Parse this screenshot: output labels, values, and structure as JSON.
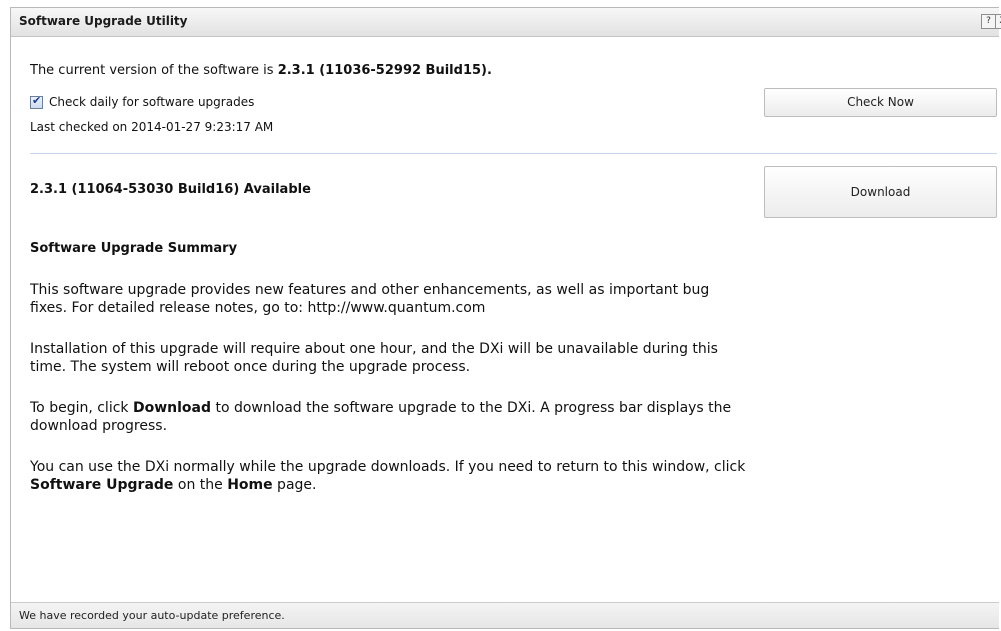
{
  "window": {
    "title": "Software Upgrade Utility",
    "help_icon": "?",
    "close_icon": "X"
  },
  "current_version": {
    "prefix": "The current version of the software is ",
    "version": "2.3.1 (11036-52992 Build15)."
  },
  "check": {
    "label": "Check daily for software upgrades",
    "checked": true,
    "last_checked": "Last checked on 2014-01-27 9:23:17 AM",
    "button": "Check Now"
  },
  "available": {
    "label": "2.3.1 (11064-53030 Build16) Available",
    "button": "Download"
  },
  "summary": {
    "title": "Software Upgrade Summary",
    "p1": "This software upgrade provides new features and other enhancements, as well as important bug fixes. For detailed release notes, go to: http://www.quantum.com",
    "p2": "Installation of this upgrade will require about one hour, and the DXi will be unavailable during this time. The system will reboot once during the upgrade process.",
    "p3a": "To begin, click ",
    "p3b": "Download",
    "p3c": " to download the software upgrade to the DXi. A progress bar displays the download progress.",
    "p4a": "You can use the DXi normally while the upgrade downloads. If you need to return to this window, click ",
    "p4b": "Software Upgrade",
    "p4c": " on the ",
    "p4d": "Home",
    "p4e": " page."
  },
  "status": {
    "message": "We have recorded your auto-update preference."
  }
}
